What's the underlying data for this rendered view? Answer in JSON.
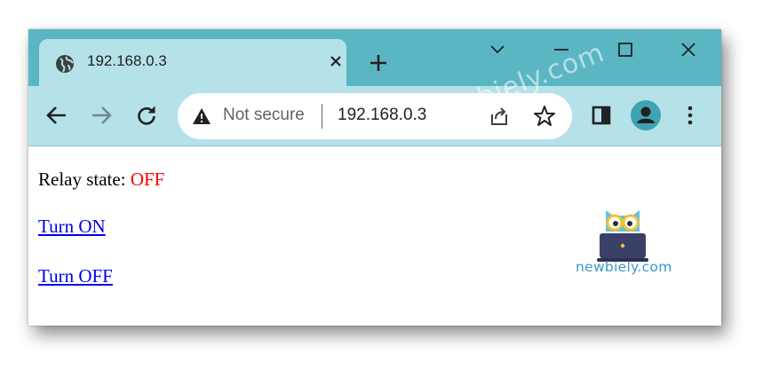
{
  "browser": {
    "tab": {
      "title": "192.168.0.3",
      "favicon": "globe-icon"
    },
    "omnibox": {
      "security_label": "Not secure",
      "url": "192.168.0.3"
    },
    "colors": {
      "frame": "#5bb6c3",
      "toolbar": "#b5e2e8"
    }
  },
  "page": {
    "relay_label": "Relay state:",
    "relay_value": "OFF",
    "links": {
      "turn_on": "Turn ON",
      "turn_off": "Turn OFF"
    },
    "colors": {
      "state_off": "#ff0000",
      "link": "#0000ee"
    }
  },
  "branding": {
    "logo_text": "newbiely.com",
    "watermark": "newbiely.com"
  }
}
